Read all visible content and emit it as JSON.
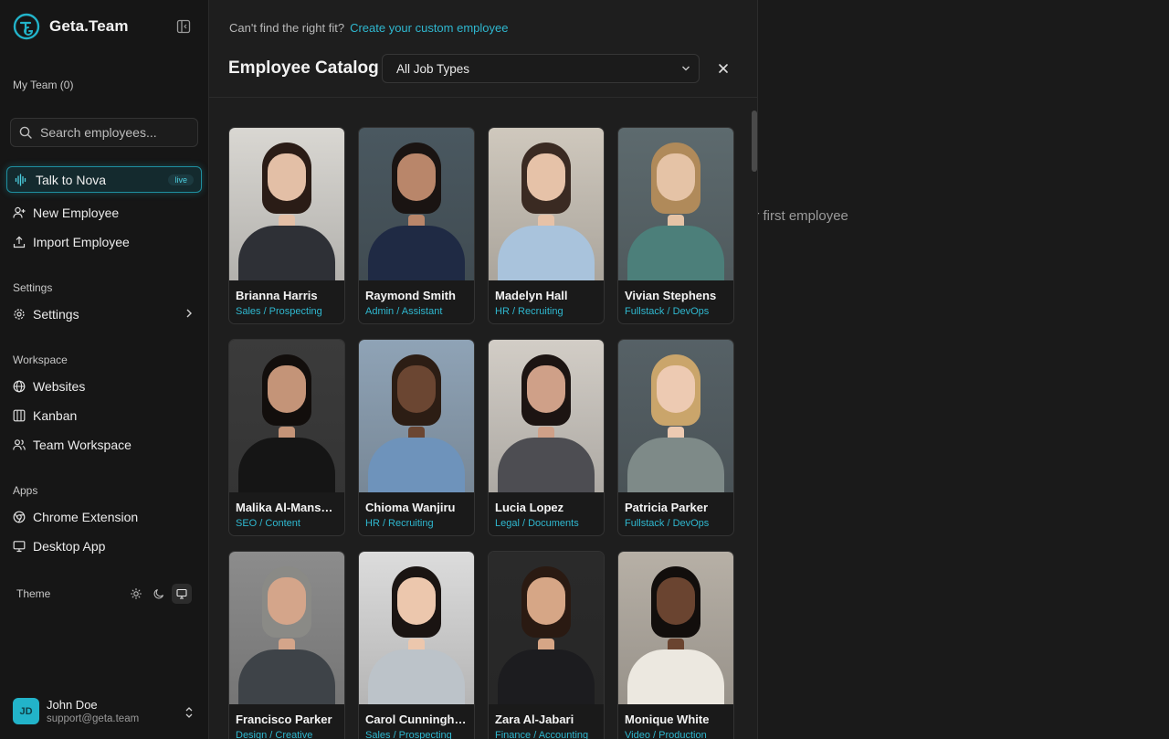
{
  "brand": {
    "name": "Geta.Team",
    "accent": "#22b3c9"
  },
  "sidebar": {
    "my_team_label": "My Team (0)",
    "search_placeholder": "Search employees...",
    "nova": {
      "label": "Talk to Nova",
      "badge": "live"
    },
    "actions": [
      {
        "label": "New Employee",
        "icon": "user-plus-icon"
      },
      {
        "label": "Import Employee",
        "icon": "upload-icon"
      }
    ],
    "settings_section": "Settings",
    "settings_item": "Settings",
    "workspace_section": "Workspace",
    "workspace_items": [
      {
        "label": "Websites",
        "icon": "globe-icon"
      },
      {
        "label": "Kanban",
        "icon": "kanban-icon"
      },
      {
        "label": "Team Workspace",
        "icon": "users-icon"
      }
    ],
    "apps_section": "Apps",
    "apps_items": [
      {
        "label": "Chrome Extension",
        "icon": "chrome-icon"
      },
      {
        "label": "Desktop App",
        "icon": "monitor-icon"
      }
    ],
    "theme_label": "Theme",
    "theme_options": [
      "sun-icon",
      "moon-icon",
      "monitor-icon"
    ],
    "theme_selected": "monitor-icon"
  },
  "user": {
    "initials": "JD",
    "name": "John Doe",
    "email": "support@geta.team"
  },
  "background_text": "ur first employee",
  "catalog": {
    "hint": "Can't find the right fit?",
    "hint_link": "Create your custom employee",
    "title": "Employee Catalog",
    "filter_value": "All Job Types",
    "employees": [
      {
        "name": "Brianna Harris",
        "role": "Sales / Prospecting"
      },
      {
        "name": "Raymond Smith",
        "role": "Admin / Assistant"
      },
      {
        "name": "Madelyn Hall",
        "role": "HR / Recruiting"
      },
      {
        "name": "Vivian Stephens",
        "role": "Fullstack / DevOps"
      },
      {
        "name": "Malika Al-Mans…",
        "role": "SEO / Content"
      },
      {
        "name": "Chioma Wanjiru",
        "role": "HR / Recruiting"
      },
      {
        "name": "Lucia Lopez",
        "role": "Legal / Documents"
      },
      {
        "name": "Patricia Parker",
        "role": "Fullstack / DevOps"
      },
      {
        "name": "Francisco Parker",
        "role": "Design / Creative"
      },
      {
        "name": "Carol Cunningh…",
        "role": "Sales / Prospecting"
      },
      {
        "name": "Zara Al-Jabari",
        "role": "Finance / Accounting"
      },
      {
        "name": "Monique White",
        "role": "Video / Production"
      }
    ]
  }
}
